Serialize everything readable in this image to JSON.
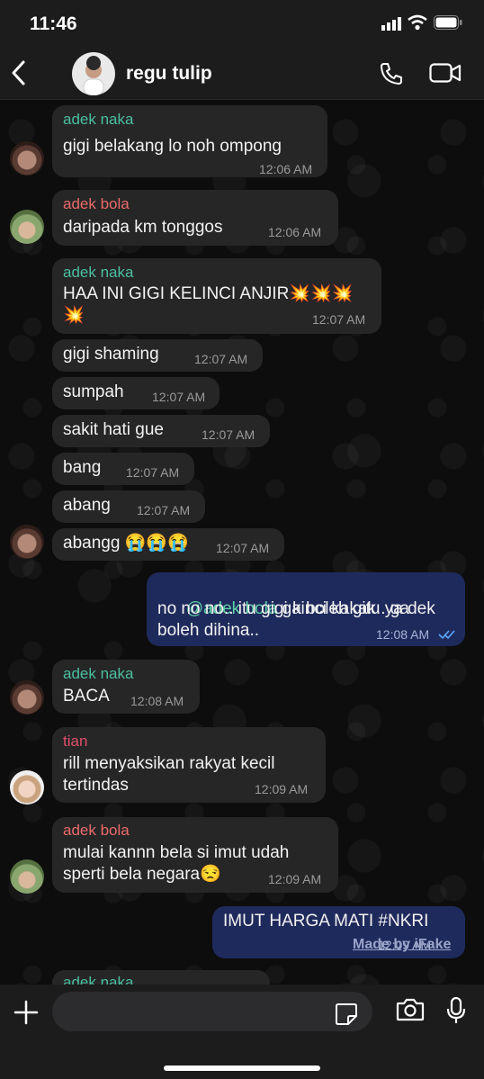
{
  "status_bar": {
    "time": "11:46"
  },
  "header": {
    "group_name": "regu tulip"
  },
  "colors": {
    "naka": "#4bbfa0",
    "bola": "#ea6a6a",
    "tian": "#e0506a",
    "outgoing_bubble": "#1f2a5c",
    "incoming_bubble": "#262626"
  },
  "messages": [
    {
      "sender": "adek naka",
      "text": "gigi belakang lo noh ompong",
      "time": "12:06 AM"
    },
    {
      "sender": "adek bola",
      "text": "daripada km tonggos",
      "time": "12:06 AM"
    },
    {
      "sender": "adek naka",
      "text_line1": "HAA INI GIGI KELINCI ANJIR💥💥💥",
      "text_line2": "💥",
      "time": "12:07 AM"
    },
    {
      "text": "gigi shaming",
      "time": "12:07 AM"
    },
    {
      "text": "sumpah",
      "time": "12:07 AM"
    },
    {
      "text": "sakit hati gue",
      "time": "12:07 AM"
    },
    {
      "text": "bang",
      "time": "12:07 AM"
    },
    {
      "text": "abang",
      "time": "12:07 AM"
    },
    {
      "text": "abangg 😭😭😭",
      "time": "12:07 AM"
    },
    {
      "mention": "@adek bola",
      "text_line1": " ga boleh gitu ya dek",
      "text_line2": "no no no.. itu gigi kinci kakak.. ga",
      "text_line3": "boleh dihina..",
      "time": "12:08 AM"
    },
    {
      "sender": "adek naka",
      "text": "BACA",
      "time": "12:08 AM"
    },
    {
      "sender": "tian",
      "text_line1": "rill menyaksikan rakyat kecil",
      "text_line2": "tertindas",
      "time": "12:09 AM"
    },
    {
      "sender": "adek bola",
      "text_line1": "mulai kannn bela si imut udah",
      "text_line2": "sperti bela negara😒",
      "time": "12:09 AM"
    },
    {
      "text": "IMUT HARGA MATI #NKRI",
      "time": "12:09 AM"
    }
  ],
  "partial_sender": "adek naka",
  "watermark": "Made by iFake"
}
